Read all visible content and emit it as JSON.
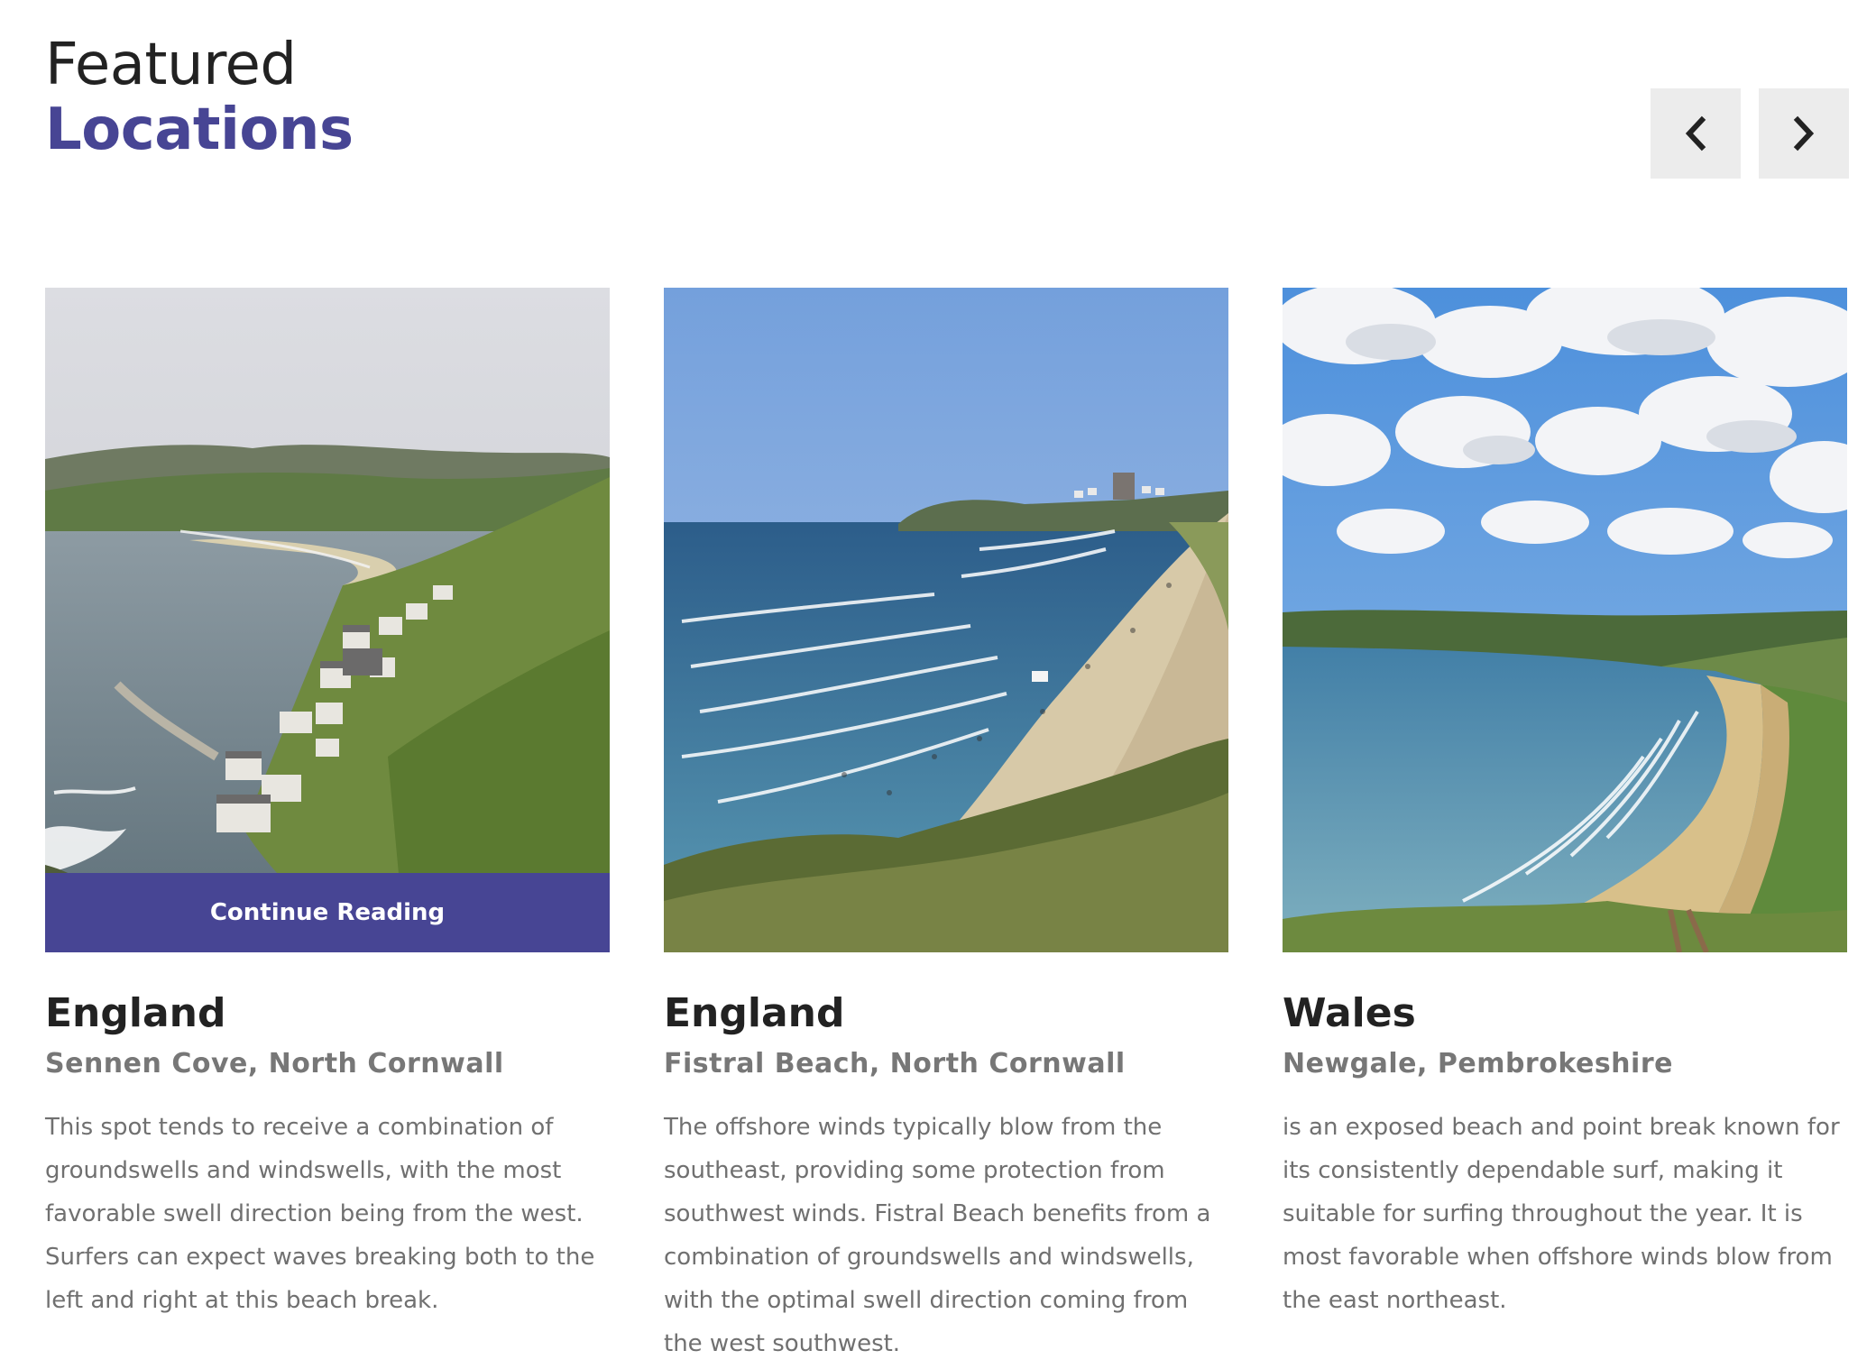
{
  "header": {
    "title_line1": "Featured",
    "title_line2": "Locations"
  },
  "nav": {
    "prev_icon": "chevron-left-icon",
    "next_icon": "chevron-right-icon"
  },
  "colors": {
    "accent": "#474594",
    "nav_bg": "#ececec",
    "heading": "#222222",
    "subheading": "#777777",
    "body_text": "#707070"
  },
  "cards": [
    {
      "country": "England",
      "location": "Sennen Cove, North Cornwall",
      "description": "This spot tends to receive a combination of groundswells and windswells, with the most favorable swell direction being from the west. Surfers can expect waves breaking both to the left and right at this beach break.",
      "continue_label": "Continue Reading"
    },
    {
      "country": "England",
      "location": "Fistral Beach, North Cornwall",
      "description": "The offshore winds typically blow from the southeast, providing some protection from southwest winds. Fistral Beach benefits from a combination of groundswells and windswells, with the optimal swell direction coming from the west southwest."
    },
    {
      "country": "Wales",
      "location": "Newgale, Pembrokeshire",
      "description": "is an exposed beach and point break known for its consistently dependable surf, making it suitable for surfing throughout the year. It is most favorable when offshore winds blow from the east northeast."
    }
  ]
}
